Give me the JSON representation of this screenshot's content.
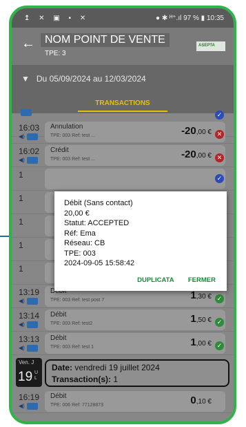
{
  "statusbar": {
    "left_icons": "↥ ✕ ▣ ▪ ✕",
    "right": "● ✱ ᴴ⁺.ıl 97 % ▮ 10:35"
  },
  "appbar": {
    "title": "NOM POINT DE VENTE",
    "tpe": "TPE: 3",
    "logo": "ASEPTA"
  },
  "filter": {
    "range": "Du 05/09/2024 au 12/03/2024"
  },
  "tabs": {
    "active": "TRANSACTIONS"
  },
  "rows": [
    {
      "time": "16:03",
      "label": "Annulation",
      "ref": "TPE: 003 Ref: test ...",
      "amount_main": "-20",
      "amount_dec": ",00 €",
      "status": "err"
    },
    {
      "time": "16:02",
      "label": "Crédit",
      "ref": "TPE: 003 Ref: test ...",
      "amount_main": "-20",
      "amount_dec": ",00 €",
      "status": "err"
    },
    {
      "time": "13:19",
      "label": "Débit",
      "ref": "TPE: 003 Ref: test post 7",
      "amount_main": "1",
      "amount_dec": ",30 €",
      "status": "ok"
    },
    {
      "time": "13:14",
      "label": "Débit",
      "ref": "TPE: 003 Ref: test2",
      "amount_main": "1",
      "amount_dec": ",50 €",
      "status": "ok"
    },
    {
      "time": "13:13",
      "label": "Débit",
      "ref": "TPE: 003 Ref: test 1",
      "amount_main": "1",
      "amount_dec": ",00 €",
      "status": "ok"
    },
    {
      "time": "16:19",
      "label": "Débit",
      "ref": "TPE: 006 Ref: 77128873",
      "amount_main": "0",
      "amount_dec": ",10 €",
      "status": "ok"
    }
  ],
  "day": {
    "name": "Ven. J",
    "num": "19",
    "suffix": "U\nL",
    "date_label": "Date:",
    "date_value": "vendredi 19 juillet 2024",
    "tx_label": "Transaction(s):",
    "tx_value": "1"
  },
  "dialog": {
    "lines": [
      "Débit (Sans contact)",
      "20,00 €",
      "Statut: ACCEPTED",
      "Réf: Ema",
      "Réseau: CB",
      "TPE: 003",
      "2024-09-05 15:58:42"
    ],
    "duplicate_label": "DUPLICATA",
    "close_label": "FERMER"
  },
  "colors": {
    "frame": "#2fb34a",
    "accent_tab": "#e5c200",
    "dialog_action": "#178a3a",
    "ok": "#2e8b3a",
    "error": "#b82424"
  }
}
